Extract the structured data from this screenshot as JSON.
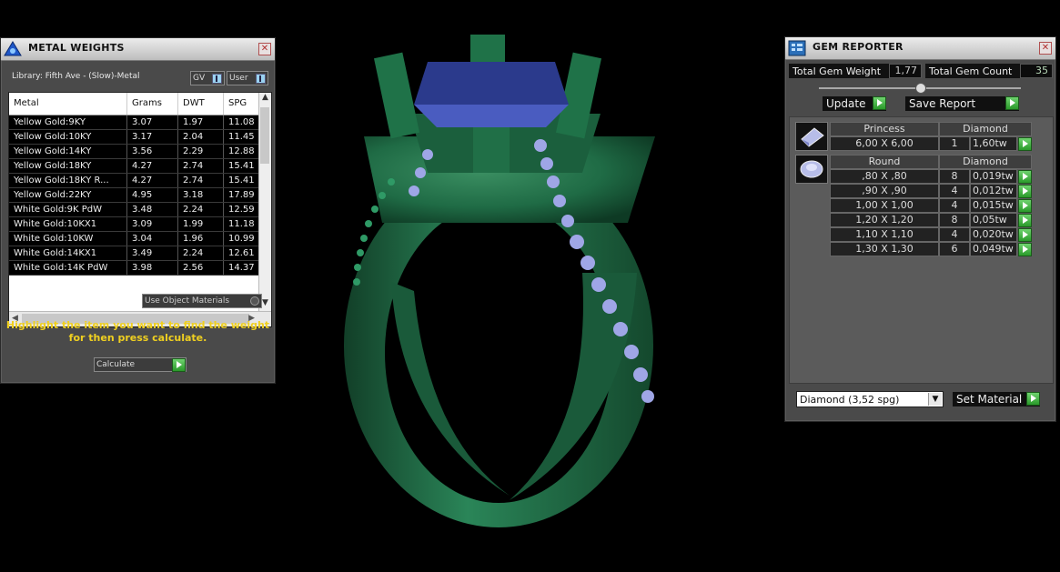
{
  "metal_weights": {
    "title": "METAL WEIGHTS",
    "library": "Library: Fifth Ave - (Slow)-Metal",
    "gv_label": "GV",
    "user_label": "User",
    "columns": [
      "Metal",
      "Grams",
      "DWT",
      "SPG"
    ],
    "rows": [
      [
        "Yellow Gold:9KY",
        "3.07",
        "1.97",
        "11.08"
      ],
      [
        "Yellow Gold:10KY",
        "3.17",
        "2.04",
        "11.45"
      ],
      [
        "Yellow Gold:14KY",
        "3.56",
        "2.29",
        "12.88"
      ],
      [
        "Yellow Gold:18KY",
        "4.27",
        "2.74",
        "15.41"
      ],
      [
        "Yellow Gold:18KY R...",
        "4.27",
        "2.74",
        "15.41"
      ],
      [
        "Yellow Gold:22KY",
        "4.95",
        "3.18",
        "17.89"
      ],
      [
        "White Gold:9K PdW",
        "3.48",
        "2.24",
        "12.59"
      ],
      [
        "White Gold:10KX1",
        "3.09",
        "1.99",
        "11.18"
      ],
      [
        "White Gold:10KW",
        "3.04",
        "1.96",
        "10.99"
      ],
      [
        "White Gold:14KX1",
        "3.49",
        "2.24",
        "12.61"
      ],
      [
        "White Gold:14K PdW",
        "3.98",
        "2.56",
        "14.37"
      ]
    ],
    "use_object_materials": "Use Object Materials",
    "hint_line1": "Highlight the item you want to find the weight",
    "hint_line2": "for then press calculate.",
    "calculate_label": "Calculate"
  },
  "gem_reporter": {
    "title": "GEM REPORTER",
    "total_weight_label": "Total Gem Weight",
    "total_weight_value": "1,77",
    "total_count_label": "Total Gem Count",
    "total_count_value": "35",
    "update_label": "Update",
    "save_report_label": "Save Report",
    "groups": [
      {
        "icon": "princess-cut-icon",
        "shape": "Princess",
        "material": "Diamond",
        "items": [
          {
            "size": "6,00 X 6,00",
            "count": "1",
            "tw": "1,60tw"
          }
        ]
      },
      {
        "icon": "round-cut-icon",
        "shape": "Round",
        "material": "Diamond",
        "items": [
          {
            "size": ",80 X ,80",
            "count": "8",
            "tw": "0,019tw"
          },
          {
            "size": ",90 X ,90",
            "count": "4",
            "tw": "0,012tw"
          },
          {
            "size": "1,00 X 1,00",
            "count": "4",
            "tw": "0,015tw"
          },
          {
            "size": "1,20 X 1,20",
            "count": "8",
            "tw": "0,05tw"
          },
          {
            "size": "1,10 X 1,10",
            "count": "4",
            "tw": "0,020tw"
          },
          {
            "size": "1,30 X 1,30",
            "count": "6",
            "tw": "0,049tw"
          }
        ]
      }
    ],
    "material_select": "Diamond      (3,52 spg)",
    "set_material_label": "Set Material"
  },
  "colors": {
    "ring_green": "#1f6b45",
    "gem_blue": "#2b3a8c",
    "side_stone": "#9fa6e6",
    "hint_yellow": "#f0d020"
  }
}
